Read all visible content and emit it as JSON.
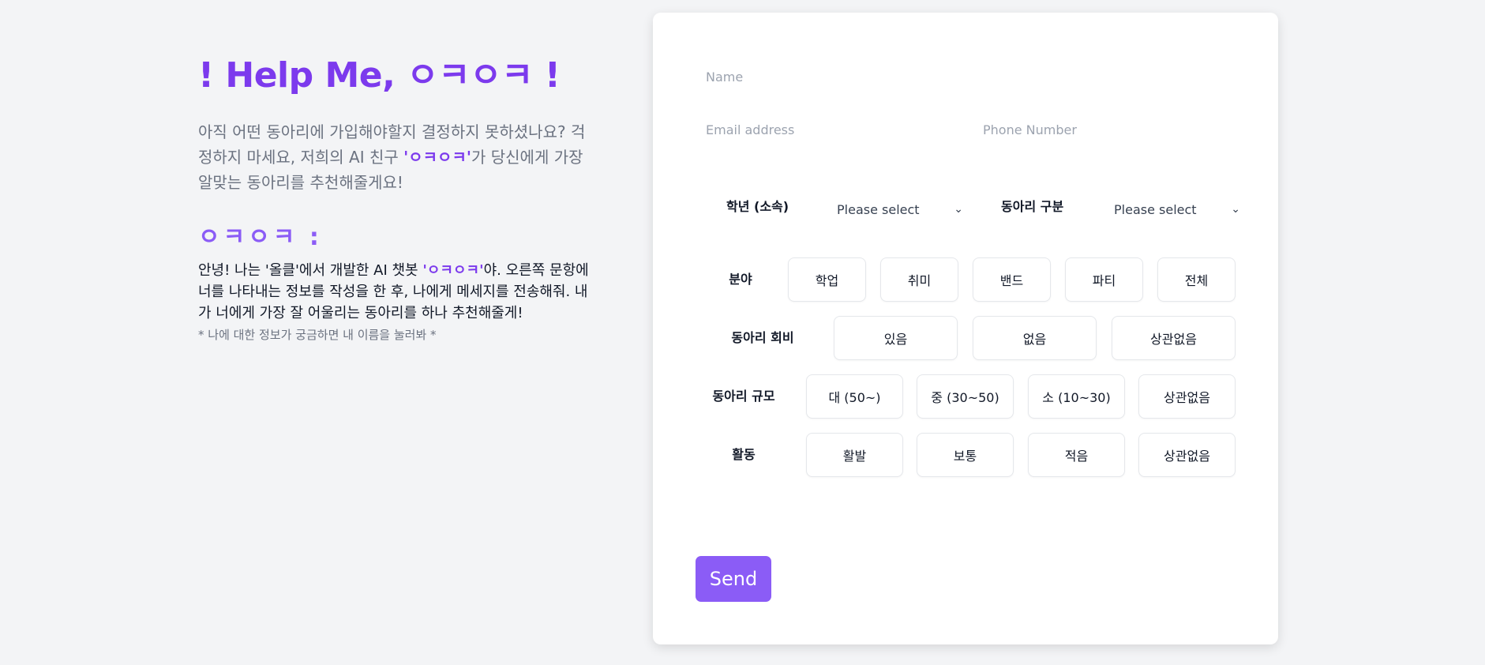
{
  "hero": {
    "title": "! Help Me, ㅇㅋㅇㅋ !",
    "intro_before": "아직 어떤 동아리에 가입해야할지 결정하지 못하셨나요? 걱정하지 마세요, 저희의 AI 친구 ",
    "intro_accent": "'ㅇㅋㅇㅋ'",
    "intro_after": "가 당신에게 가장 알맞는 동아리를 추천해줄게요!"
  },
  "bot": {
    "name": "ㅇㅋㅇㅋ :",
    "desc_before": "안녕! 나는 '올클'에서 개발한 AI 챗봇 ",
    "desc_accent": "'ㅇㅋㅇㅋ'",
    "desc_after": "야. 오른쪽 문항에 너를 나타내는 정보를 작성을 한 후, 나에게 메세지를 전송해줘. 내가 너에게 가장 잘 어울리는 동아리를 하나 추천해줄게!",
    "hint": "* 나에 대한 정보가 궁금하면 내 이름을 눌러봐 *"
  },
  "form": {
    "name_placeholder": "Name",
    "email_placeholder": "Email address",
    "phone_placeholder": "Phone Number",
    "grade_label": "학년 (소속)",
    "grade_value": "Please select",
    "type_label": "동아리 구분",
    "type_value": "Please select",
    "rows": [
      {
        "label": "분야",
        "options": [
          "학업",
          "취미",
          "밴드",
          "파티",
          "전체"
        ]
      },
      {
        "label": "동아리 회비",
        "options": [
          "있음",
          "없음",
          "상관없음"
        ]
      },
      {
        "label": "동아리 규모",
        "options": [
          "대 (50~)",
          "중 (30~50)",
          "소 (10~30)",
          "상관없음"
        ]
      },
      {
        "label": "활동",
        "options": [
          "활발",
          "보통",
          "적음",
          "상관없음"
        ]
      }
    ],
    "send_label": "Send"
  },
  "colors": {
    "accent": "#7c3aed",
    "button": "#8b5cf6",
    "background": "#f3f4f6"
  }
}
